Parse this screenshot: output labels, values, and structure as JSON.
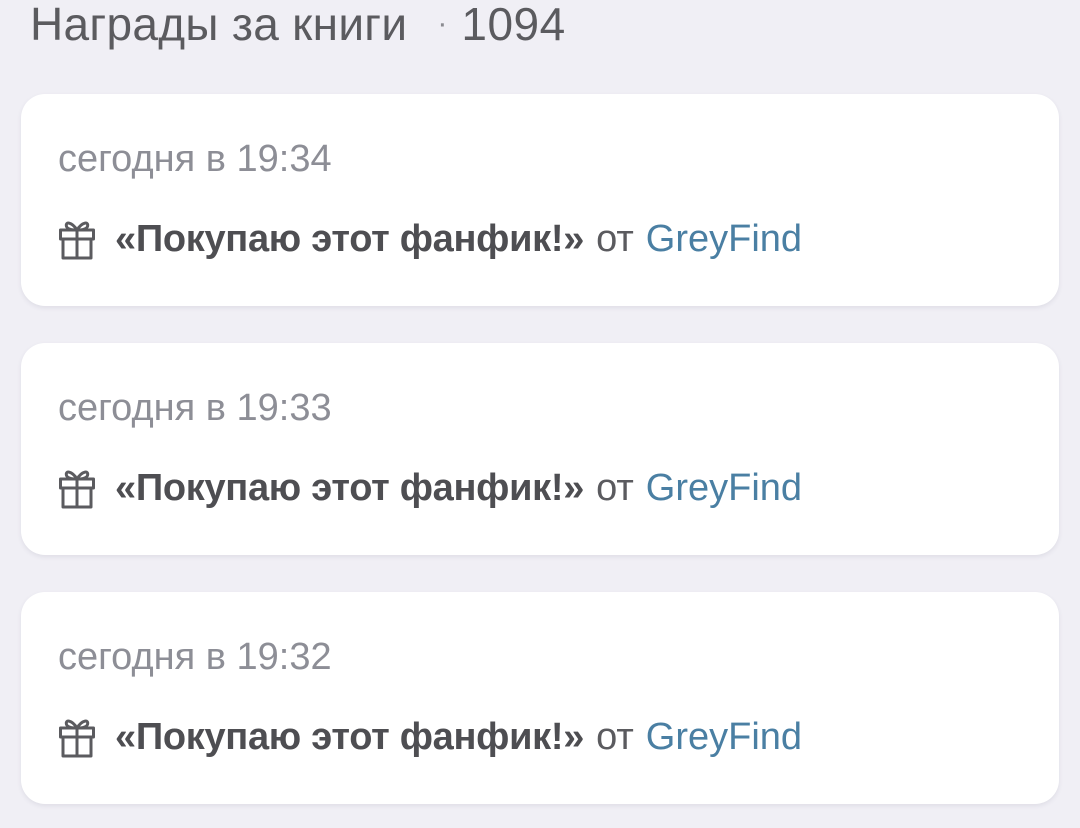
{
  "header": {
    "title": "Награды за книги",
    "separator": "·",
    "count": "1094"
  },
  "awards": [
    {
      "date": "сегодня в 19:34",
      "icon": "gift-icon",
      "reward": "«Покупаю этот фанфик!»",
      "from": "от",
      "author": "GreyFind"
    },
    {
      "date": "сегодня в 19:33",
      "icon": "gift-icon",
      "reward": "«Покупаю этот фанфик!»",
      "from": "от",
      "author": "GreyFind"
    },
    {
      "date": "сегодня в 19:32",
      "icon": "gift-icon",
      "reward": "«Покупаю этот фанфик!»",
      "from": "от",
      "author": "GreyFind"
    }
  ],
  "colors": {
    "background": "#f0eff5",
    "card": "#ffffff",
    "date_text": "#8d8e96",
    "reward_text": "#4e4e52",
    "author_link": "#4a7fa3"
  }
}
